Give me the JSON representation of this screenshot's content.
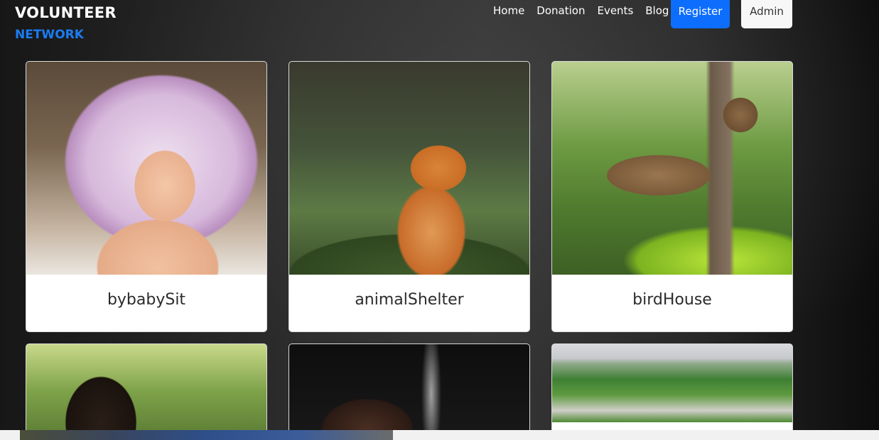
{
  "brand": {
    "line1": "VOLUNTEER",
    "line2": "NETWORK"
  },
  "nav": {
    "items": [
      "Home",
      "Donation",
      "Events",
      "Blog"
    ],
    "register": "Register",
    "admin": "Admin"
  },
  "cards": [
    {
      "title": "bybabySit",
      "image": "baby-under-blanket"
    },
    {
      "title": "animalShelter",
      "image": "fox-in-grass"
    },
    {
      "title": "birdHouse",
      "image": "birdhouses-in-forest"
    },
    {
      "title": "",
      "image": "girl-with-braids"
    },
    {
      "title": "",
      "image": "water-splash-hands"
    },
    {
      "title": "",
      "image": "city-park-aerial"
    }
  ],
  "colors": {
    "accent": "#0d6efd",
    "brand_sub": "#1a7cf4"
  }
}
